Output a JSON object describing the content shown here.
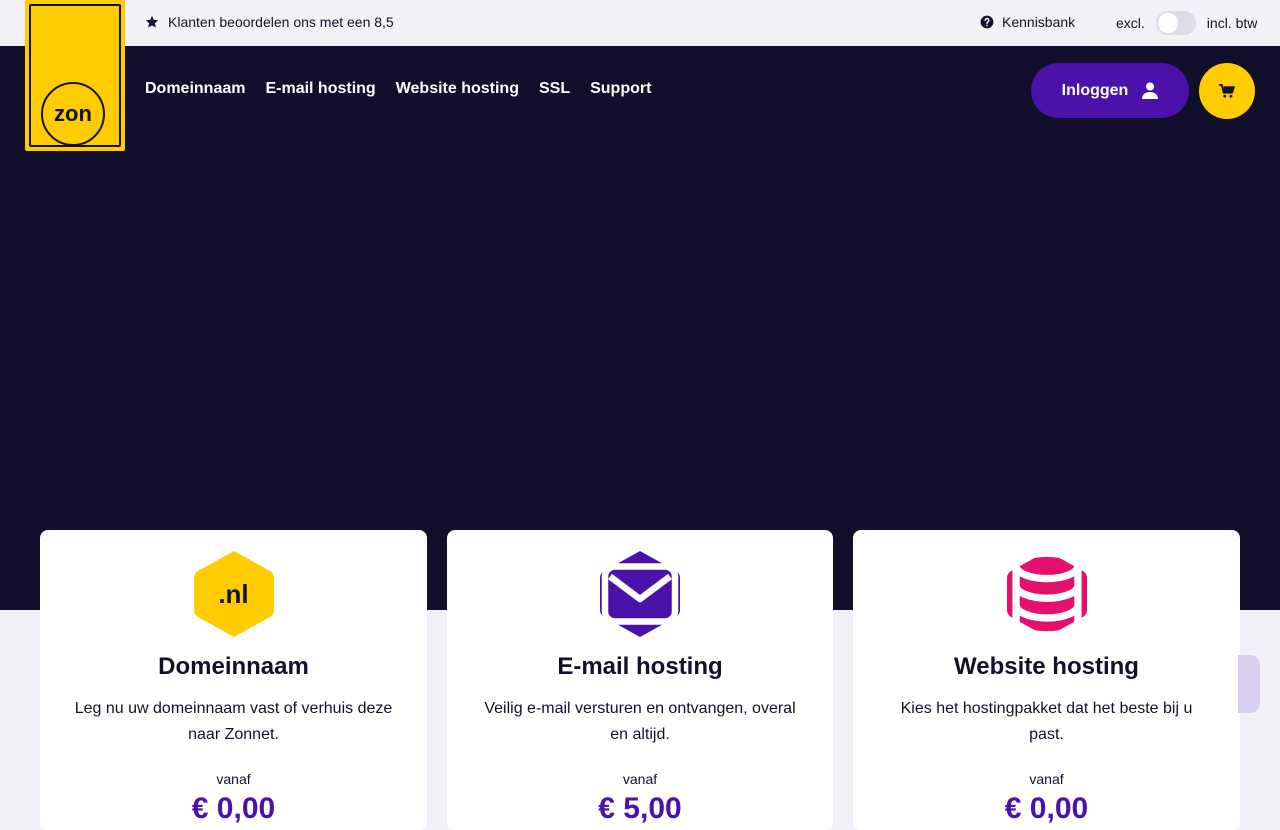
{
  "topbar": {
    "rating_text": "Klanten beoordelen ons met een 8,5",
    "kennisbank": "Kennisbank",
    "excl": "excl.",
    "incl": "incl. btw"
  },
  "logo": {
    "text": "zon"
  },
  "nav": {
    "items": [
      "Domeinnaam",
      "E-mail hosting",
      "Website hosting",
      "SSL",
      "Support"
    ]
  },
  "login": {
    "label": "Inloggen"
  },
  "colors": {
    "hero": "#110f2c",
    "accent_yellow": "#ffcc00",
    "accent_purple": "#4a12a8",
    "accent_pink": "#e5106b"
  },
  "cards": [
    {
      "title": "Domeinnaam",
      "icon_text": ".nl",
      "description": "Leg nu uw domeinnaam vast of verhuis deze naar Zonnet.",
      "vanaf": "vanaf",
      "price": "€ 0,00"
    },
    {
      "title": "E-mail hosting",
      "icon": "envelope-icon",
      "description": "Veilig e-mail versturen en ontvangen, overal en altijd.",
      "vanaf": "vanaf",
      "price": "€ 5,00"
    },
    {
      "title": "Website hosting",
      "icon": "database-icon",
      "description": "Kies het hostingpakket dat het beste bij u past.",
      "vanaf": "vanaf",
      "price": "€ 0,00"
    }
  ]
}
